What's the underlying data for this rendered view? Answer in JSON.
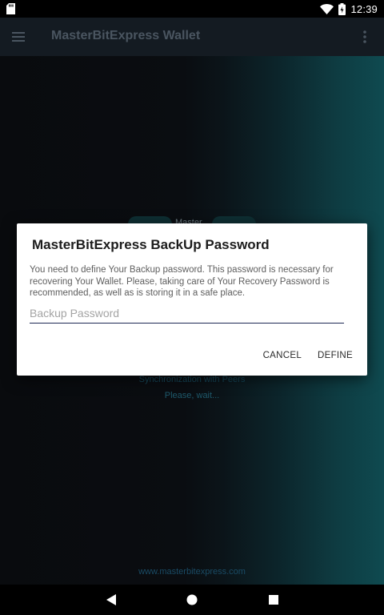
{
  "status_bar": {
    "time": "12:39",
    "icons": [
      "sd-card-icon",
      "wifi-icon",
      "battery-icon"
    ]
  },
  "app_bar": {
    "title": "MasterBitExpress Wallet",
    "icons": [
      "menu-icon",
      "overflow-menu-icon"
    ]
  },
  "background": {
    "partial_label": "Master",
    "sync_text": "Synchronization with Peers",
    "wait_text": "Please, wait...",
    "footer_link": "www.masterbitexpress.com"
  },
  "dialog": {
    "title": "MasterBitExpress BackUp Password",
    "message": "You need to define Your Backup password. This password is necessary for recovering Your Wallet. Please, taking care of Your Recovery Password is recommended, as well as is storing it in a safe place.",
    "input": {
      "value": "",
      "placeholder": "Backup Password"
    },
    "cancel_label": "CANCEL",
    "define_label": "DEFINE"
  },
  "nav_bar": {
    "icons": [
      "back-icon",
      "home-icon",
      "recents-icon"
    ]
  },
  "colors": {
    "app_bar": "#141b22",
    "title_text": "#4a5560",
    "input_underline": "#1f2a55",
    "teal_edge": "#0f4a50"
  }
}
